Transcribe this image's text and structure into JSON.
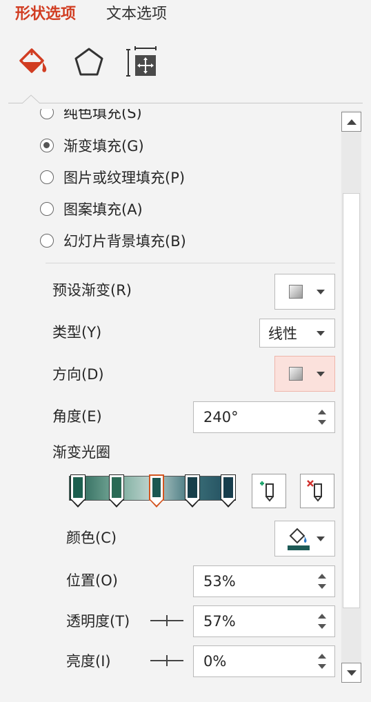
{
  "tabs": {
    "shape_options": "形状选项",
    "text_options": "文本选项"
  },
  "icons": {
    "fill_line": "paint-bucket-icon",
    "effects": "pentagon-icon",
    "size_properties": "size-layout-icon"
  },
  "fill_types": [
    {
      "label": "纯色填充(S)",
      "checked": false
    },
    {
      "label": "渐变填充(G)",
      "checked": true
    },
    {
      "label": "图片或纹理填充(P)",
      "checked": false
    },
    {
      "label": "图案填充(A)",
      "checked": false
    },
    {
      "label": "幻灯片背景填充(B)",
      "checked": false
    }
  ],
  "preset_gradient": {
    "label": "预设渐变(R)"
  },
  "type": {
    "label": "类型(Y)",
    "value": "线性"
  },
  "direction": {
    "label": "方向(D)"
  },
  "angle": {
    "label": "角度(E)",
    "value": "240°"
  },
  "gradient_stops": {
    "label": "渐变光圈",
    "stops": [
      "#1d5f4f",
      "#2a6a55",
      "#1b5751",
      "#173f4a",
      "#173d4c"
    ],
    "selected_index": 2
  },
  "color": {
    "label": "颜色(C)",
    "accent": "#1d5a56"
  },
  "position": {
    "label": "位置(O)",
    "value": "53%"
  },
  "transparency": {
    "label": "透明度(T)",
    "value": "57%"
  },
  "brightness": {
    "label": "亮度(I)",
    "value": "0%"
  },
  "colors": {
    "active_tab": "#d13d22",
    "selected_stop": "#d3541f",
    "highlight": "#fbe1dc"
  }
}
